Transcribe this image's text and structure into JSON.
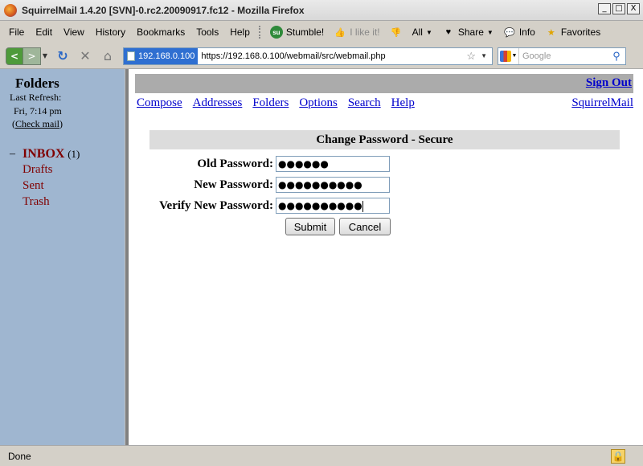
{
  "window": {
    "title": "SquirrelMail 1.4.20 [SVN]-0.rc2.20090917.fc12 - Mozilla Firefox",
    "controls": {
      "minimize": "_",
      "maximize": "□",
      "close": "X"
    }
  },
  "menubar": {
    "items": [
      "File",
      "Edit",
      "View",
      "History",
      "Bookmarks",
      "Tools",
      "Help"
    ],
    "toolbar": {
      "stumble": "Stumble!",
      "like": "I like it!",
      "all": "All",
      "share": "Share",
      "info": "Info",
      "favorites": "Favorites"
    }
  },
  "navbar": {
    "identity": "192.168.0.100",
    "url": "https://192.168.0.100/webmail/src/webmail.php",
    "search_placeholder": "Google"
  },
  "left": {
    "title": "Folders",
    "last_refresh_label": "Last Refresh:",
    "last_refresh_time": "Fri, 7:14 pm",
    "check_mail": "Check mail",
    "folders": {
      "inbox": "INBOX",
      "inbox_count": "(1)",
      "drafts": "Drafts",
      "sent": "Sent",
      "trash": "Trash"
    }
  },
  "main": {
    "sign_out": "Sign Out",
    "nav": [
      "Compose",
      "Addresses",
      "Folders",
      "Options",
      "Search",
      "Help"
    ],
    "brand_link": "SquirrelMail",
    "form": {
      "header": "Change Password - Secure",
      "old_label": "Old Password:",
      "old_value": "●●●●●●",
      "new_label": "New Password:",
      "new_value": "●●●●●●●●●●",
      "verify_label": "Verify New Password:",
      "verify_value": "●●●●●●●●●●",
      "submit": "Submit",
      "cancel": "Cancel"
    }
  },
  "status": {
    "text": "Done"
  },
  "colors": {
    "left_pane": "#9fb6d0",
    "link": "#0000cc",
    "folder": "#800000"
  }
}
